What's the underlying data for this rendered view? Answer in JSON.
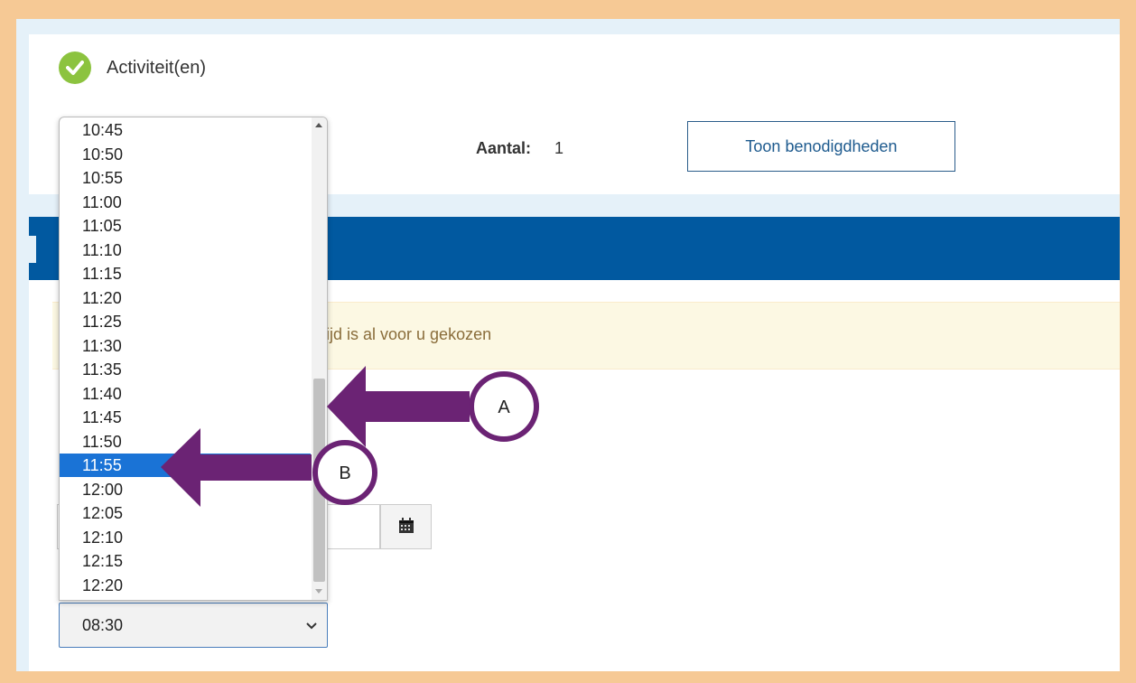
{
  "activity": {
    "title": "Activiteit(en)"
  },
  "summary": {
    "aantal_label": "Aantal:",
    "aantal_value": "1",
    "toon_button": "Toon benodigdheden"
  },
  "alert": {
    "text": "tijd is al voor u gekozen"
  },
  "time_select": {
    "selected_value": "08:30",
    "highlighted_option": "11:55",
    "options": [
      "10:45",
      "10:50",
      "10:55",
      "11:00",
      "11:05",
      "11:10",
      "11:15",
      "11:20",
      "11:25",
      "11:30",
      "11:35",
      "11:40",
      "11:45",
      "11:50",
      "11:55",
      "12:00",
      "12:05",
      "12:10",
      "12:15",
      "12:20"
    ]
  },
  "callouts": {
    "a": "A",
    "b": "B"
  },
  "icons": {
    "check": "check-circle-icon",
    "calendar": "calendar-icon",
    "chevron": "chevron-down-icon"
  },
  "colors": {
    "accent": "#0159a0",
    "callout": "#6b2374",
    "highlight": "#1a73d6",
    "frame": "#f6c995"
  }
}
